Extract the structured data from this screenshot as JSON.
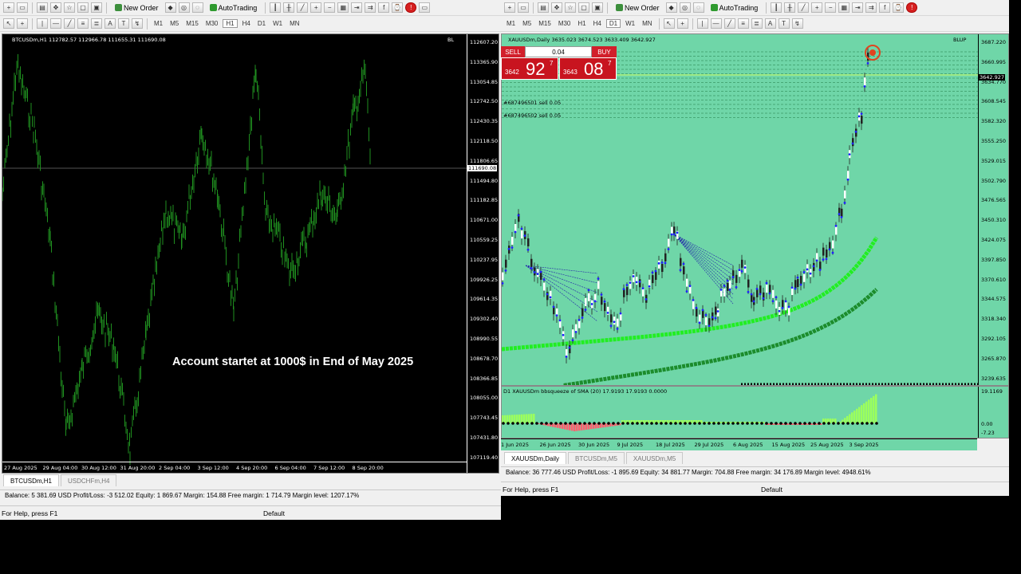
{
  "toolbar": {
    "new_order": "New Order",
    "autotrading": "AutoTrading",
    "timeframes": [
      "M1",
      "M5",
      "M15",
      "M30",
      "H1",
      "H4",
      "D1",
      "W1",
      "MN"
    ]
  },
  "left": {
    "chart_title": "BTCUSDm,H1  112782.57 112966.78 111655.31 111690.08",
    "tag": "BL",
    "price_labels": [
      "112607.20",
      "113365.90",
      "113054.85",
      "112742.50",
      "112430.35",
      "112118.50",
      "111806.65",
      "111494.80",
      "111182.85",
      "110671.00",
      "110559.25",
      "110237.95",
      "109926.25",
      "109614.35",
      "109302.40",
      "108990.55",
      "108678.70",
      "108366.85",
      "108055.00",
      "107743.45",
      "107431.80",
      "107119.40"
    ],
    "current_price": "111690.08",
    "date_labels": [
      "27 Aug 2025",
      "29 Aug 04:00",
      "30 Aug 12:00",
      "31 Aug 20:00",
      "2 Sep 04:00",
      "3 Sep 12:00",
      "4 Sep 20:00",
      "6 Sep 04:00",
      "7 Sep 12:00",
      "8 Sep 20:00"
    ],
    "overlay_text": "Account startet at 1000$ in End of May 2025",
    "tabs": [
      "BTCUSDm,H1",
      "USDCHFm,H4"
    ],
    "balance_line": "Balance: 5 381.69 USD  Profit/Loss: -3 512.02  Equity: 1 869.67  Margin: 154.88  Free margin: 1 714.79  Margin level: 1207.17%",
    "help": "For Help, press F1",
    "profile": "Default",
    "colors": {
      "background": "#000000",
      "candles": "#1f8f1f"
    }
  },
  "right": {
    "chart_title": "XAUUSDm,Daily  3635.023 3674.523 3633.409 3642.927",
    "tag": "BLUP",
    "trade": {
      "sell_label": "SELL",
      "buy_label": "BUY",
      "lot": "0.04",
      "sell_small": "3642",
      "sell_big": "92",
      "sell_sup": "7",
      "buy_small": "3643",
      "buy_big": "08",
      "buy_sup": "7"
    },
    "order_labels": [
      "#687496501 sell 0.05",
      "#687496502 sell 0.05"
    ],
    "price_labels": [
      "3687.220",
      "3660.995",
      "3634.770",
      "3608.545",
      "3582.320",
      "3555.250",
      "3529.015",
      "3502.790",
      "3476.565",
      "3450.310",
      "3424.075",
      "3397.850",
      "3370.610",
      "3344.575",
      "3318.340",
      "3292.105",
      "3265.870",
      "3239.635"
    ],
    "current_price": "3642.927",
    "indicator_title": "D1 XAUUSDm bbsqueeze of SMA (20) 17.9193 17.9193 0.0000",
    "indicator_labels": [
      "19.1169",
      "0.00",
      "-7.23"
    ],
    "date_labels": [
      "1 Jun 2025",
      "26 Jun 2025",
      "30 Jun 2025",
      "9 Jul 2025",
      "18 Jul 2025",
      "29 Jul 2025",
      "6 Aug 2025",
      "15 Aug 2025",
      "25 Aug 2025",
      "3 Sep 2025"
    ],
    "tabs": [
      "XAUUSDm,Daily",
      "BTCUSDm,M5",
      "XAUUSDm,M5"
    ],
    "balance_line": "Balance: 36 777.46 USD  Profit/Loss: -1 895.69  Equity: 34 881.77  Margin: 704.88  Free margin: 34 176.89  Margin level: 4948.61%",
    "help": "For Help, press F1",
    "profile": "Default",
    "colors": {
      "background": "#6fd6a8",
      "fast_ma": "#22ee22",
      "slow_ma": "#1c8c2c",
      "candles": "#2020ff"
    }
  }
}
